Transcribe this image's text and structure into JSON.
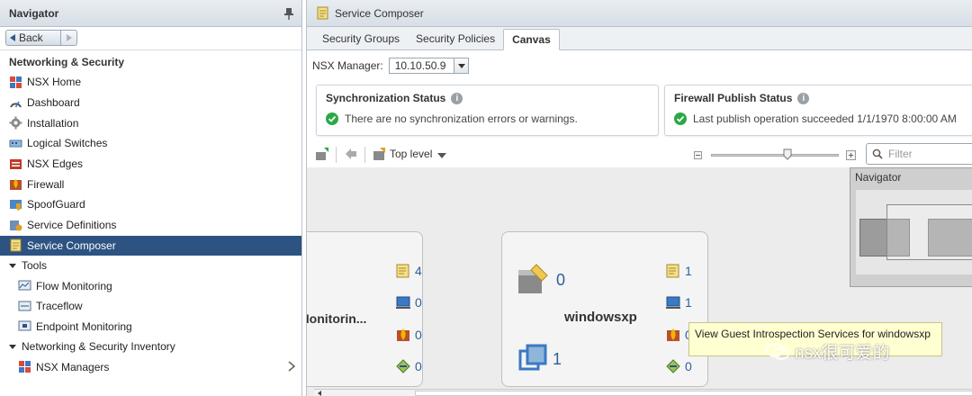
{
  "navigator": {
    "title": "Navigator",
    "back_label": "Back",
    "section_title": "Networking & Security",
    "items": [
      {
        "label": "NSX Home",
        "icon": "nsx-home-icon"
      },
      {
        "label": "Dashboard",
        "icon": "dashboard-icon"
      },
      {
        "label": "Installation",
        "icon": "installation-gear-icon"
      },
      {
        "label": "Logical Switches",
        "icon": "logical-switch-icon"
      },
      {
        "label": "NSX Edges",
        "icon": "nsx-edge-icon"
      },
      {
        "label": "Firewall",
        "icon": "firewall-icon"
      },
      {
        "label": "SpoofGuard",
        "icon": "spoofguard-icon"
      },
      {
        "label": "Service Definitions",
        "icon": "service-definition-icon"
      },
      {
        "label": "Service Composer",
        "icon": "service-composer-icon",
        "selected": true
      }
    ],
    "tools_label": "Tools",
    "tools": [
      {
        "label": "Flow Monitoring",
        "icon": "flow-monitoring-icon"
      },
      {
        "label": "Traceflow",
        "icon": "traceflow-icon"
      },
      {
        "label": "Endpoint Monitoring",
        "icon": "endpoint-monitoring-icon"
      }
    ],
    "inventory_label": "Networking & Security Inventory",
    "inventory": [
      {
        "label": "NSX Managers",
        "icon": "nsx-manager-icon"
      }
    ]
  },
  "main": {
    "title": "Service Composer",
    "tabs": [
      {
        "label": "Security Groups",
        "active": false
      },
      {
        "label": "Security Policies",
        "active": false
      },
      {
        "label": "Canvas",
        "active": true
      }
    ],
    "manager_label": "NSX Manager:",
    "manager_value": "10.10.50.9",
    "sync": {
      "title": "Synchronization Status",
      "text": "There are no synchronization errors or warnings."
    },
    "publish": {
      "title": "Firewall Publish Status",
      "text": "Last publish operation succeeded 1/1/1970 8:00:00 AM"
    },
    "toolbar": {
      "level_label": "Top level",
      "filter_placeholder": "Filter",
      "zoom_level": 0.6
    },
    "cards": [
      {
        "name": "Monitorin...",
        "policies": "4",
        "guest": "0",
        "firewall": "0",
        "network": "0"
      },
      {
        "name": "windowsxp",
        "members": "0",
        "vms": "1",
        "policies": "1",
        "guest": "1",
        "firewall": "0",
        "network": "0"
      }
    ],
    "mini_navigator_title": "Navigator",
    "tooltip": "View Guest Introspection Services for windowsxp",
    "watermark": "nsx很可爱的"
  },
  "colors": {
    "selected": "#2d5382",
    "accent": "#2e5e9a",
    "ok": "#2aa845",
    "tooltip_bg": "#ffffd2"
  }
}
